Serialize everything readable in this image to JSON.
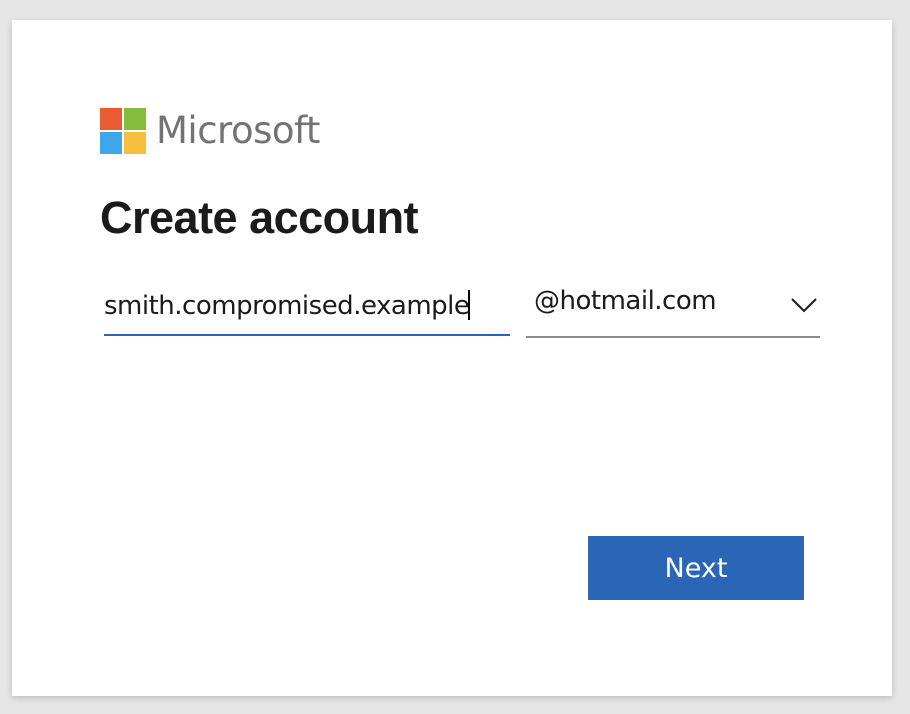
{
  "brand": {
    "name": "Microsoft",
    "logo_colors": [
      "#f25022",
      "#7fba00",
      "#00a4ef",
      "#ffb900"
    ],
    "text_color": "#737373"
  },
  "page": {
    "title": "Create account"
  },
  "form": {
    "email_value": "smith.compromised.example",
    "domain_selected": "@hotmail.com",
    "domain_icon": "chevron-down-icon"
  },
  "actions": {
    "next_label": "Next",
    "accent_color": "#2a66b5"
  }
}
